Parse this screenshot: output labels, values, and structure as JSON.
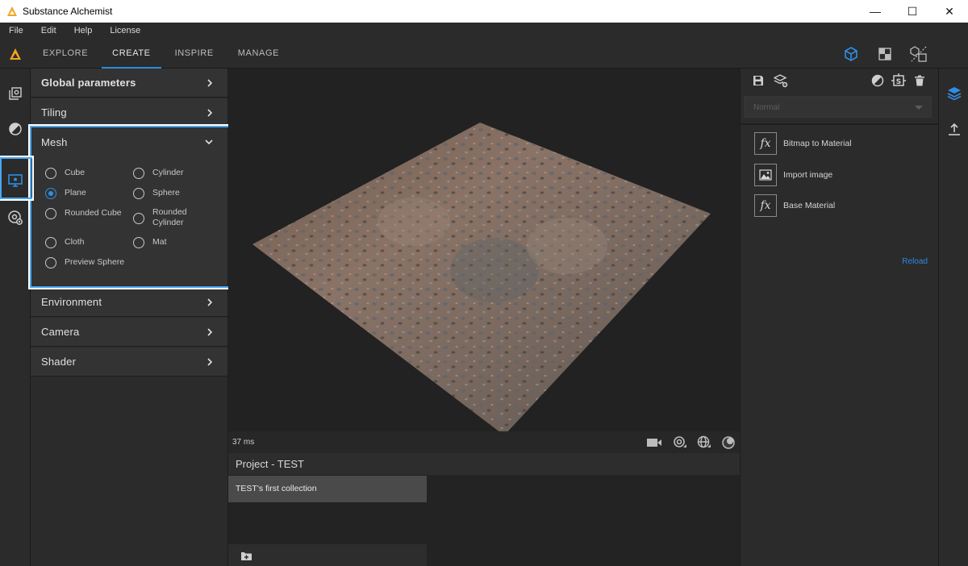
{
  "window": {
    "title": "Substance Alchemist",
    "minimize": "—",
    "maximize": "☐",
    "close": "✕"
  },
  "menu": [
    "File",
    "Edit",
    "Help",
    "License"
  ],
  "nav": {
    "tabs": [
      "EXPLORE",
      "CREATE",
      "INSPIRE",
      "MANAGE"
    ],
    "active_tab": "CREATE"
  },
  "left_panel": {
    "sections": {
      "global": "Global parameters",
      "tiling": "Tiling",
      "mesh": "Mesh",
      "environment": "Environment",
      "camera": "Camera",
      "shader": "Shader"
    },
    "mesh_options": [
      "Cube",
      "Cylinder",
      "Plane",
      "Sphere",
      "Rounded Cube",
      "Rounded Cylinder",
      "Cloth",
      "Mat",
      "Preview Sphere"
    ],
    "mesh_selected": "Plane"
  },
  "viewport": {
    "render_time": "37 ms"
  },
  "project": {
    "title": "Project - TEST",
    "collection": "TEST's first collection"
  },
  "right_panel": {
    "blend_mode": "Normal",
    "items": [
      {
        "icon": "fx-icon",
        "glyph": "fx",
        "label": "Bitmap to Material"
      },
      {
        "icon": "image-icon",
        "glyph": "",
        "label": "Import image"
      },
      {
        "icon": "fx-icon",
        "glyph": "fx",
        "label": "Base Material"
      }
    ],
    "reload": "Reload"
  },
  "colors": {
    "accent": "#2a8bdc",
    "highlight": "#4aa6f0",
    "panel": "#2b2b2b",
    "viewport": "#222222"
  }
}
